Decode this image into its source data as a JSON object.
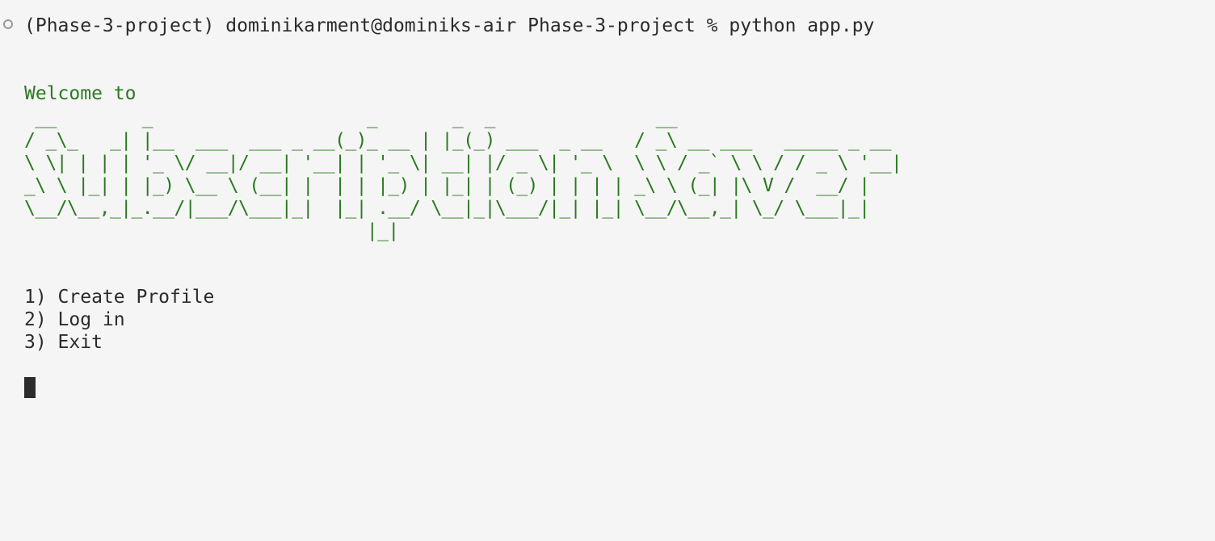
{
  "terminal": {
    "command_line": "(Phase-3-project) dominikarment@dominiks-air Phase-3-project % python app.py",
    "welcome": "Welcome to",
    "banner_lines": [
      " __        _                    _       _  _               __",
      "/ _\\_   _| |__  ___  ___ _ __(_)_ __ | |_(_) ___  _ __   / _\\ __ ___   _____ _ __",
      "\\ \\| | | | '_ \\/ __|/ __| '__| | '_ \\| __| |/ _ \\| '_ \\  \\ \\ / _` \\ \\ / / _ \\ '__|",
      "_\\ \\ |_| | |_) \\__ \\ (__| |  | | |_) | |_| | (_) | | | | _\\ \\ (_| |\\ V /  __/ |",
      "\\__/\\__,_|_.__/|___/\\___|_|  |_| .__/ \\__|_|\\___/|_| |_| \\__/\\__,_| \\_/ \\___|_|",
      "                                |_|"
    ],
    "menu": [
      "1) Create Profile",
      "2) Log in",
      "3) Exit"
    ],
    "colors": {
      "background": "#f5f5f5",
      "text": "#2b2b2b",
      "green": "#2a7a1f"
    }
  }
}
